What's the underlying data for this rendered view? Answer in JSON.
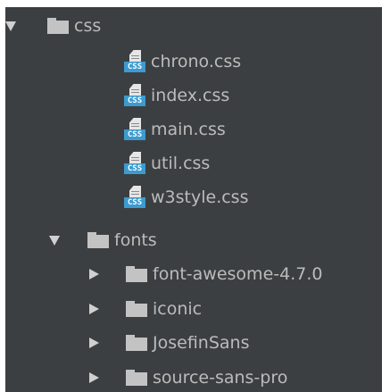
{
  "tree": {
    "css_folder": {
      "label": "css",
      "files": [
        {
          "label": "chrono.css"
        },
        {
          "label": "index.css"
        },
        {
          "label": "main.css"
        },
        {
          "label": "util.css"
        },
        {
          "label": "w3style.css"
        }
      ],
      "file_icon_tag": "CSS"
    },
    "fonts_folder": {
      "label": "fonts",
      "children": [
        {
          "label": "font-awesome-4.7.0"
        },
        {
          "label": "iconic"
        },
        {
          "label": "JosefinSans"
        },
        {
          "label": "source-sans-pro"
        }
      ]
    }
  },
  "colors": {
    "panel_background": "#3c3f41",
    "text": "#bbbbbb",
    "css_icon_accent": "#3c9bd0"
  }
}
